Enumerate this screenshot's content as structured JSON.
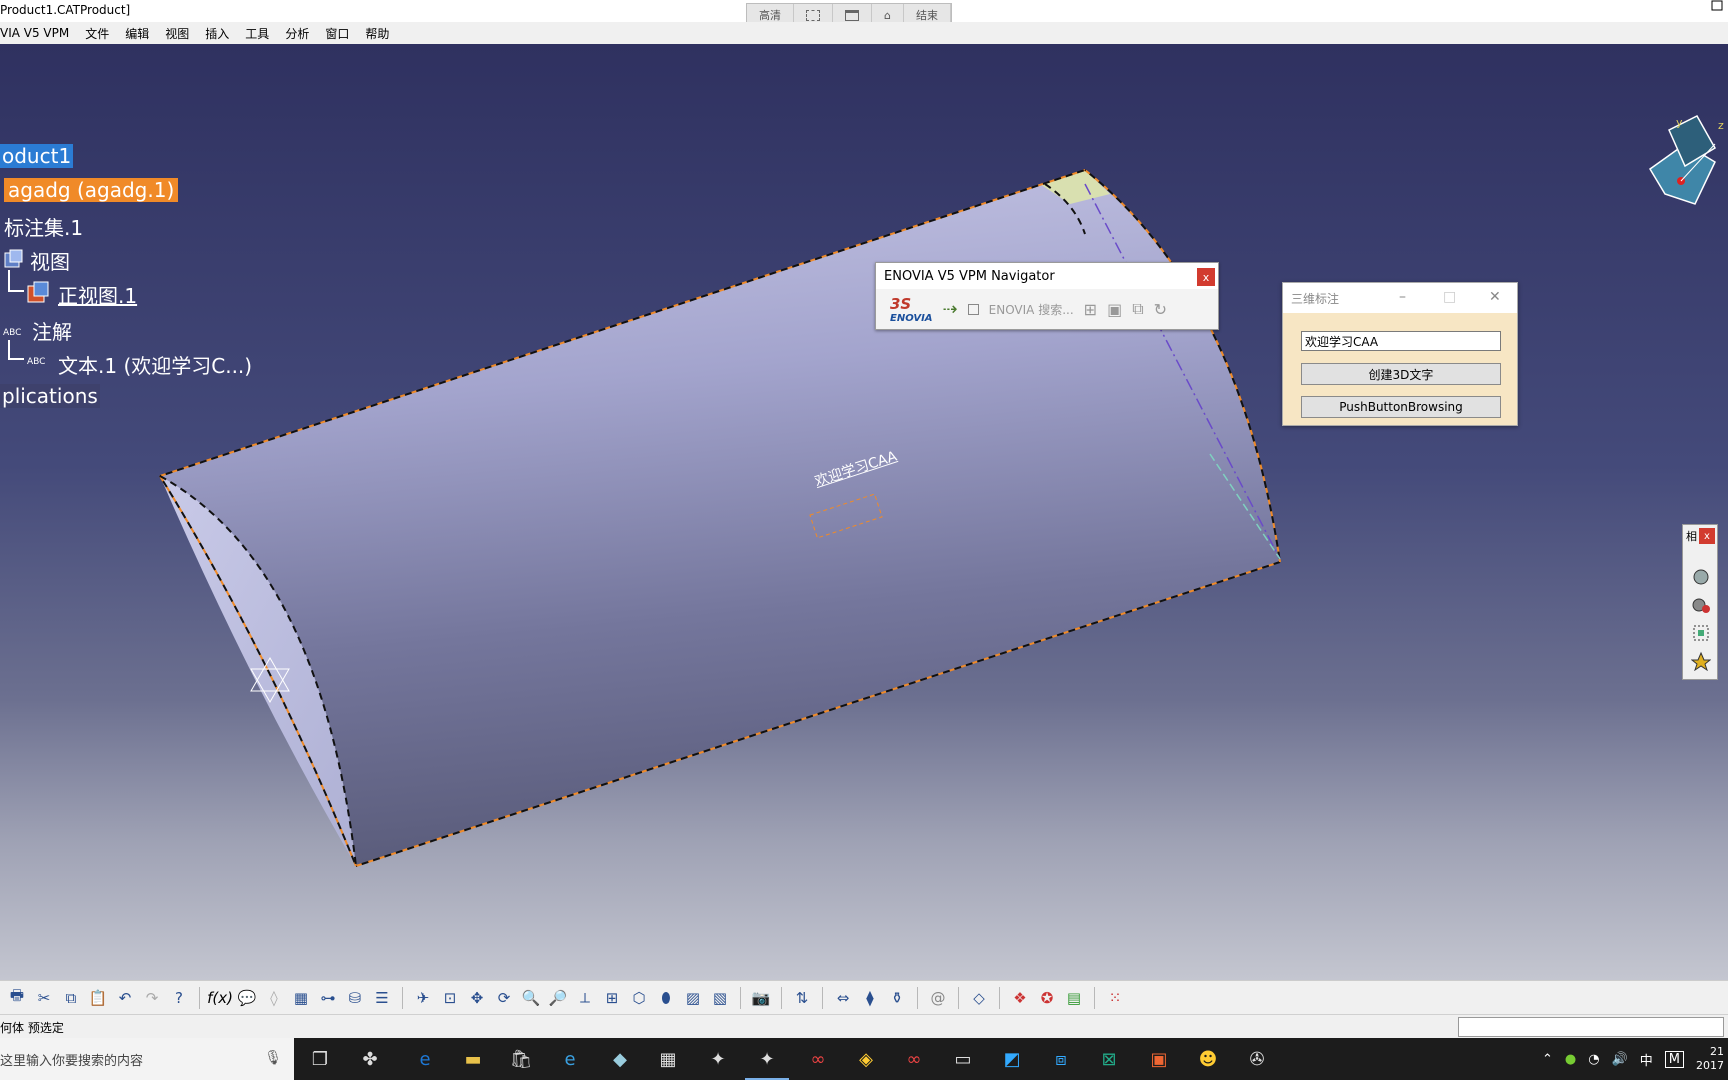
{
  "window": {
    "title": "Product1.CATProduct]",
    "top_toolbar": [
      "高清",
      "",
      "",
      "",
      "结束"
    ]
  },
  "menu": [
    "VIA V5 VPM",
    "文件",
    "编辑",
    "视图",
    "插入",
    "工具",
    "分析",
    "窗口",
    "帮助"
  ],
  "tree": {
    "root": "oduct1",
    "part": "agadg (agadg.1)",
    "annotation_set": "标注集.1",
    "views": "视图",
    "front_view": "正视图.1",
    "notes": "注解",
    "text": "文本.1 (欢迎学习C...)",
    "applications": "plications"
  },
  "model": {
    "label": "欢迎学习CAA"
  },
  "enovia": {
    "title": "ENOVIA V5 VPM Navigator",
    "close": "x",
    "logo": "ENOVIA",
    "search_label": "ENOVIA 搜索..."
  },
  "dialog": {
    "title": "三维标注",
    "min": "–",
    "max": "□",
    "close": "✕",
    "input_value": "欢迎学习CAA",
    "create_btn": "创建3D文字",
    "browse_btn": "PushButtonBrowsing"
  },
  "right_toolbar": {
    "caption": "相",
    "close": "x"
  },
  "status": {
    "text": "何体 预选定"
  },
  "taskbar": {
    "search_placeholder": "这里输入你要搜索的内容",
    "ime": "中",
    "m": "M",
    "clock_time": "21",
    "clock_date": "2017"
  },
  "colors": {
    "viewport_top": "#2f3160",
    "selection_blue": "#2b7cd4",
    "selection_orange": "#f08a28",
    "close_red": "#d23b2f"
  }
}
